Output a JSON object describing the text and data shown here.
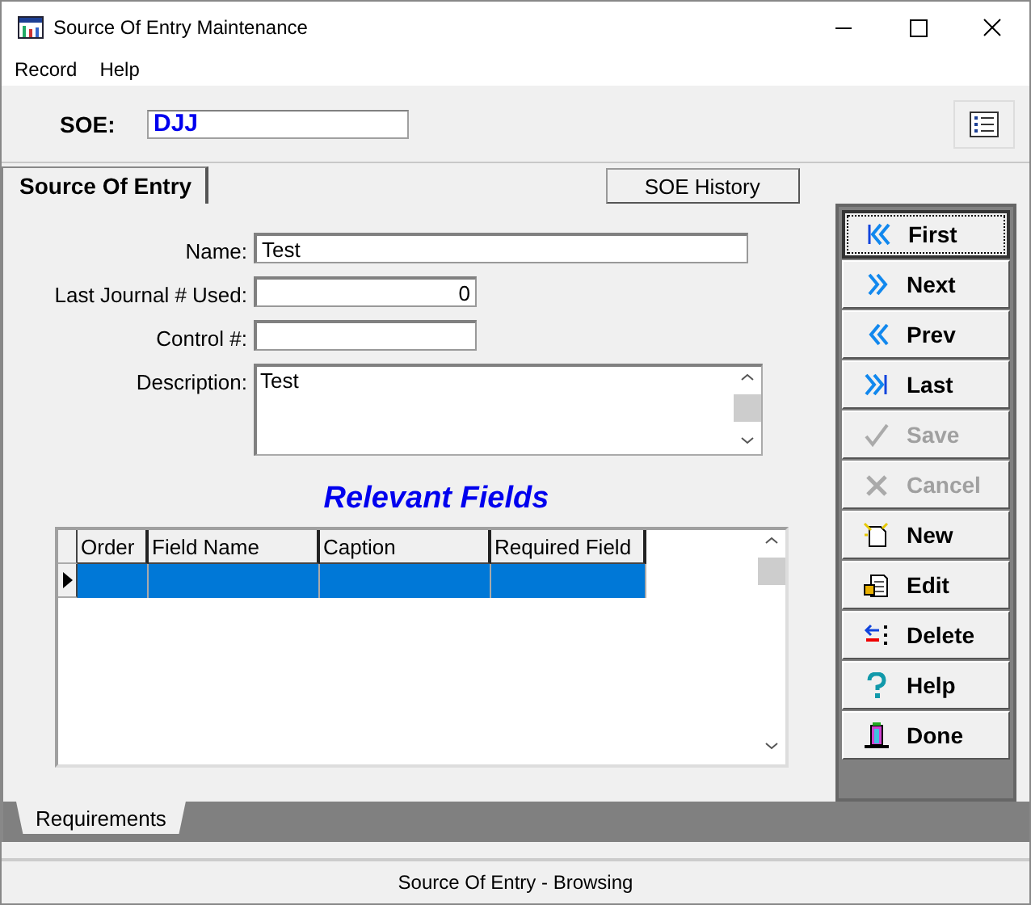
{
  "window": {
    "title": "Source Of Entry Maintenance"
  },
  "menu": [
    "Record",
    "Help"
  ],
  "soe": {
    "label": "SOE:",
    "value": "DJJ"
  },
  "tabs": [
    {
      "label": "Source Of Entry",
      "selected": true
    }
  ],
  "history_button": "SOE History",
  "form": [
    {
      "label": "Name:",
      "value": "Test",
      "kind": "wide"
    },
    {
      "label": "Last Journal # Used:",
      "value": "0",
      "kind": "number"
    },
    {
      "label": "Control #:",
      "kind": "short"
    },
    {
      "label": "Description:",
      "value": "Test",
      "kind": "memo"
    }
  ],
  "relevant_title": "Relevant Fields",
  "grid": {
    "columns": [
      "Order",
      "Field Name",
      "Caption",
      "Required Field"
    ],
    "rows": [
      {
        "selected": true
      }
    ]
  },
  "bottom_tabs": [
    {
      "label": "Requirements",
      "selected": true
    }
  ],
  "buttons": [
    {
      "label": "First",
      "kind": "first",
      "disabled": false,
      "focused": true
    },
    {
      "label": "Next",
      "kind": "next",
      "disabled": false,
      "focused": false
    },
    {
      "label": "Prev",
      "kind": "prev",
      "disabled": false,
      "focused": false
    },
    {
      "label": "Last",
      "kind": "last",
      "disabled": false,
      "focused": false
    },
    {
      "label": "Save",
      "kind": "save",
      "disabled": true,
      "focused": false
    },
    {
      "label": "Cancel",
      "kind": "cancel",
      "disabled": true,
      "focused": false
    },
    {
      "label": "New",
      "kind": "new",
      "disabled": false,
      "focused": false
    },
    {
      "label": "Edit",
      "kind": "edit",
      "disabled": false,
      "focused": false
    },
    {
      "label": "Delete",
      "kind": "delete",
      "disabled": false,
      "focused": false
    },
    {
      "label": "Help",
      "kind": "help",
      "disabled": false,
      "focused": false
    },
    {
      "label": "Done",
      "kind": "done",
      "disabled": false,
      "focused": false
    }
  ],
  "status_bar": "Source Of Entry - Browsing"
}
